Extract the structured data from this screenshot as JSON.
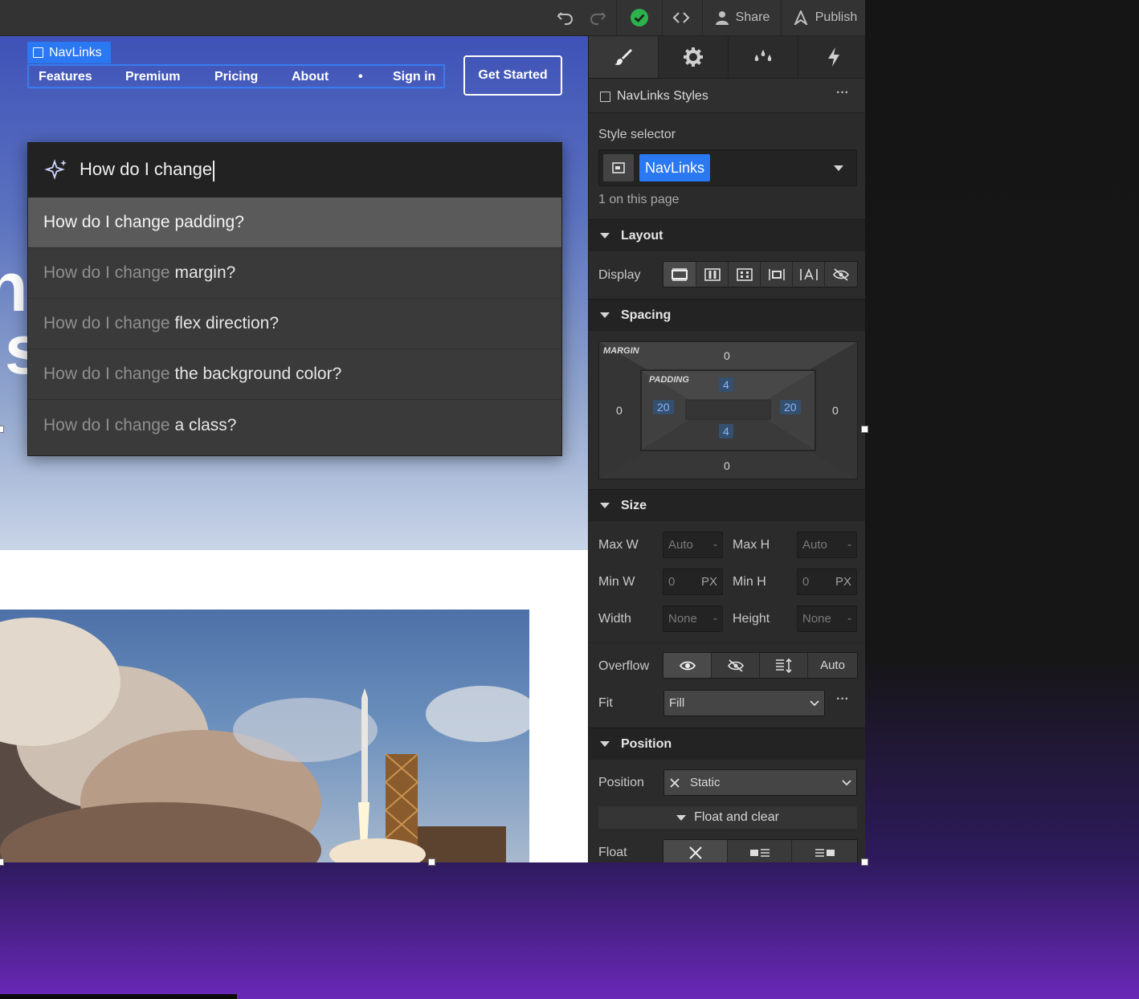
{
  "topbar": {
    "share_label": "Share",
    "publish_label": "Publish"
  },
  "canvas": {
    "nav_tag": "NavLinks",
    "nav_links": [
      "Features",
      "Premium",
      "Pricing",
      "About",
      "•",
      "Sign in"
    ],
    "get_started_label": "Get Started",
    "hero_text_fragments": [
      "n",
      "ls"
    ]
  },
  "ai_assistant": {
    "query": "How do I change",
    "suggestions": [
      {
        "prefix": "How do I change",
        "rest": "padding?"
      },
      {
        "prefix": "How do I change",
        "rest": "margin?"
      },
      {
        "prefix": "How do I change",
        "rest": "flex direction?"
      },
      {
        "prefix": "How do I change",
        "rest": "the background color?"
      },
      {
        "prefix": "How do I change",
        "rest": "a class?"
      }
    ]
  },
  "panel": {
    "tabs": [
      "paintbrush-icon",
      "gear-icon",
      "drops-icon",
      "lightning-icon"
    ],
    "element_title": "NavLinks Styles",
    "style_selector_label": "Style selector",
    "selector_chip": "NavLinks",
    "on_page_text": "1 on this page",
    "layout": {
      "title": "Layout",
      "display_label": "Display"
    },
    "spacing": {
      "title": "Spacing",
      "margin_label": "MARGIN",
      "padding_label": "PADDING",
      "margin": {
        "top": "0",
        "right": "0",
        "bottom": "0",
        "left": "0"
      },
      "padding": {
        "top": "4",
        "right": "20",
        "bottom": "4",
        "left": "20"
      }
    },
    "size": {
      "title": "Size",
      "max_w_label": "Max W",
      "max_w_value": "Auto",
      "max_w_unit": "-",
      "max_h_label": "Max H",
      "max_h_value": "Auto",
      "max_h_unit": "-",
      "min_w_label": "Min W",
      "min_w_value": "0",
      "min_w_unit": "PX",
      "min_h_label": "Min H",
      "min_h_value": "0",
      "min_h_unit": "PX",
      "width_label": "Width",
      "width_value": "None",
      "width_unit": "-",
      "height_label": "Height",
      "height_value": "None",
      "height_unit": "-"
    },
    "overflow_label": "Overflow",
    "overflow_auto": "Auto",
    "fit_label": "Fit",
    "fit_value": "Fill",
    "position": {
      "title": "Position",
      "position_label": "Position",
      "position_value": "Static",
      "float_clear_label": "Float and clear",
      "float_label": "Float"
    }
  },
  "colors": {
    "accent": "#2a78f2",
    "panel_bg": "#2b2b2b",
    "publish_status": "#2bb24c"
  }
}
